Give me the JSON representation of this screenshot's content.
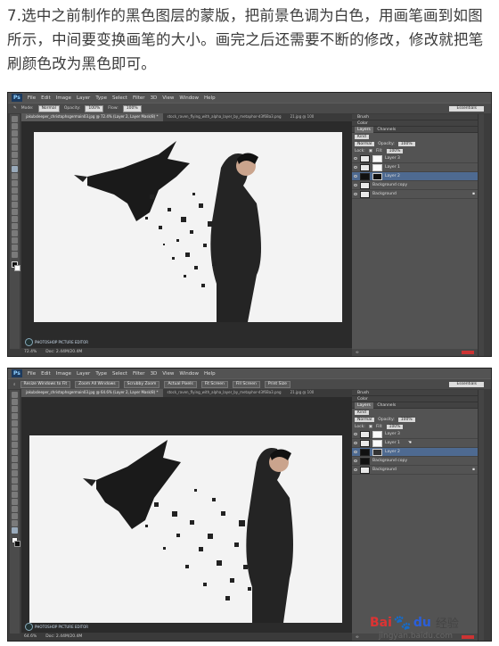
{
  "instruction": "7.选中之前制作的黑色图层的蒙版，把前景色调为白色，用画笔画到如图所示，中间要变换画笔的大小。画完之后还需要不断的修改，修改就把笔刷颜色改为黑色即可。",
  "ps": {
    "logo": "Ps",
    "menus": [
      "File",
      "Edit",
      "Image",
      "Layer",
      "Type",
      "Select",
      "Filter",
      "3D",
      "View",
      "Window",
      "Help"
    ],
    "workspace": "Essentials"
  },
  "shot1": {
    "options": {
      "mode_label": "Mode:",
      "mode_value": "Normal",
      "opacity_label": "Opacity:",
      "opacity_value": "100%",
      "flow_label": "Flow:",
      "flow_value": "100%"
    },
    "tabs": [
      "jakubsleeper_christophsgermain03.jpg @ 72.4% (Layer 2, Layer Mask/8) *",
      "stock_raven_flying_with_alpha_layer_by_metaphor-d3f6Ba3.png",
      "21.jpg @ 100"
    ],
    "status_zoom": "72.4%",
    "status_doc": "Doc: 2.44M/20.4M",
    "layers": {
      "tab_layers": "Layers",
      "tab_channels": "Channels",
      "kind": "Kind",
      "blend": "Normal",
      "opacity_label": "Opacity:",
      "opacity_value": "100%",
      "lock_label": "Lock:",
      "fill_label": "Fill:",
      "fill_value": "100%",
      "rows": [
        "Layer 3",
        "Layer 1",
        "Layer 2",
        "Background copy",
        "Background"
      ],
      "selected": 2
    },
    "panel_brush": "Brush",
    "panel_color": "Color"
  },
  "shot2": {
    "options": {
      "resize_label": "Resize Windows to Fit",
      "zoom_all_label": "Zoom All Windows",
      "scrubby_label": "Scrubby Zoom",
      "actual_pixels": "Actual Pixels",
      "fit_screen": "Fit Screen",
      "fill_screen": "Fill Screen",
      "print_size": "Print Size"
    },
    "tabs": [
      "jakubsleeper_christophsgermain03.jpg @ 64.6% (Layer 2, Layer Mask/8) *",
      "stock_raven_flying_with_alpha_layer_by_metaphor-d3f6Ba3.png",
      "21.jpg @ 100"
    ],
    "status_zoom": "64.6%",
    "status_doc": "Doc: 2.44M/20.4M",
    "layers": {
      "tab_layers": "Layers",
      "tab_channels": "Channels",
      "kind": "Kind",
      "blend": "Normal",
      "opacity_label": "Opacity:",
      "opacity_value": "100%",
      "lock_label": "Lock:",
      "fill_label": "Fill:",
      "fill_value": "100%",
      "rows": [
        "Layer 3",
        "Layer 1",
        "Layer 2",
        "Background copy",
        "Background"
      ],
      "selected": 2
    },
    "panel_brush": "Brush",
    "panel_color": "Color"
  },
  "watermark": "PHOTOSHOP PICTURE EDITOR",
  "baidu": {
    "bai": "Bai",
    "du": "du",
    "jingyan": "经验",
    "url": "jingyan.baidu.com"
  }
}
